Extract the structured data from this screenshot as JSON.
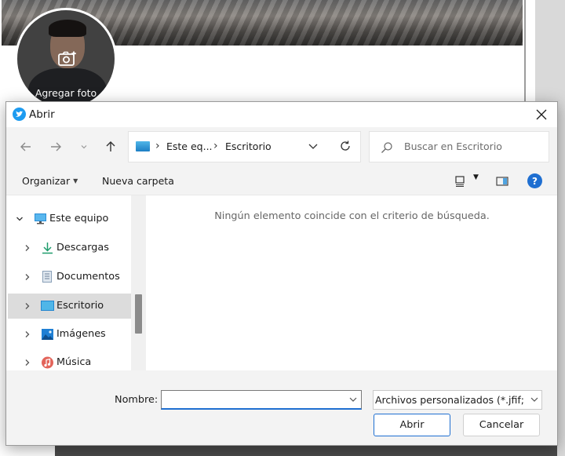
{
  "background": {
    "avatar_label": "Agregar foto"
  },
  "dialog": {
    "title": "Abrir",
    "address": {
      "root": "Este eq...",
      "current": "Escritorio"
    },
    "search": {
      "placeholder": "Buscar en Escritorio"
    },
    "commands": {
      "organize": "Organizar",
      "new_folder": "Nueva carpeta"
    },
    "tree": [
      {
        "label": "Este equipo",
        "icon": "computer-icon",
        "expanded": true
      },
      {
        "label": "Descargas",
        "icon": "download-icon"
      },
      {
        "label": "Documentos",
        "icon": "documents-icon"
      },
      {
        "label": "Escritorio",
        "icon": "desktop-icon",
        "selected": true
      },
      {
        "label": "Imágenes",
        "icon": "pictures-icon"
      },
      {
        "label": "Música",
        "icon": "music-icon"
      }
    ],
    "empty_message": "Ningún elemento coincide con el criterio de búsqueda.",
    "footer": {
      "filename_label": "Nombre:",
      "filename_value": "",
      "filetype": "Archivos personalizados (*.jfif;*.p",
      "open_button": "Abrir",
      "cancel_button": "Cancelar"
    }
  },
  "colors": {
    "accent": "#1f6fd1",
    "twitter_blue": "#1d9bf0",
    "selection": "#dcdcdc"
  }
}
